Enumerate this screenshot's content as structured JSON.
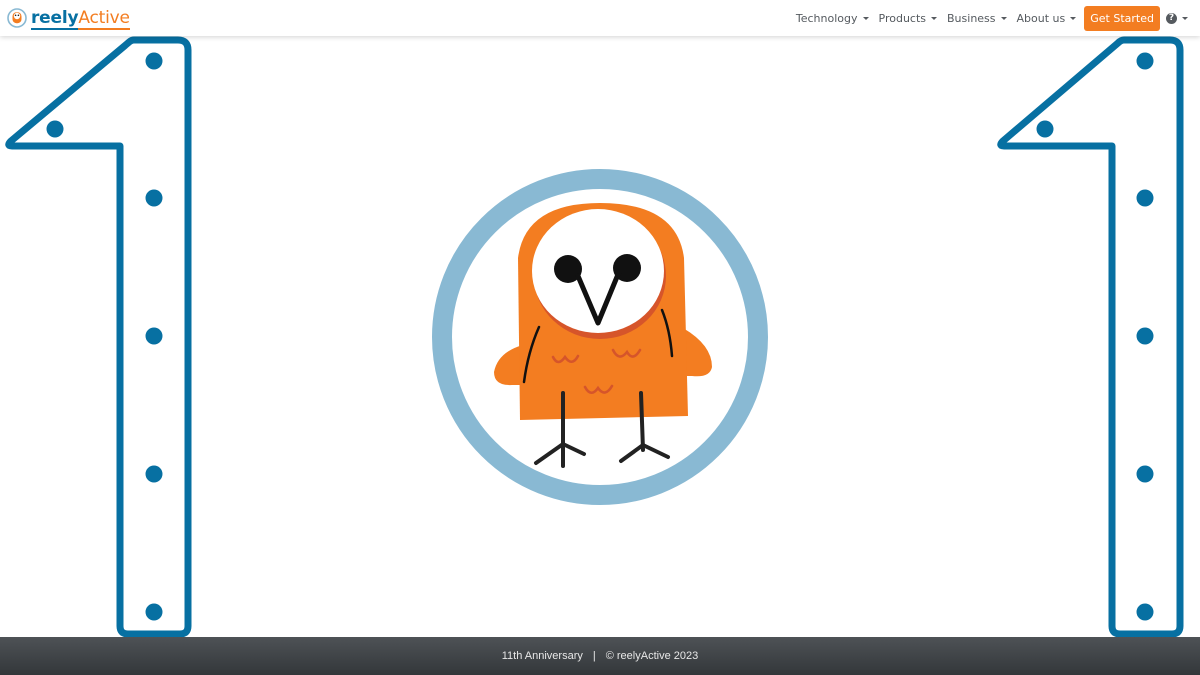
{
  "brand": {
    "name_part1": "reely",
    "name_part2": "Active"
  },
  "nav": {
    "items": [
      {
        "label": "Technology",
        "has_dropdown": true
      },
      {
        "label": "Products",
        "has_dropdown": true
      },
      {
        "label": "Business",
        "has_dropdown": true
      },
      {
        "label": "About us",
        "has_dropdown": true
      }
    ],
    "cta_label": "Get Started",
    "help_icon": "question-circle-icon"
  },
  "hero": {
    "digits": [
      "1",
      "1"
    ],
    "mascot": "owl-mascot",
    "colors": {
      "primary": "#0770a2",
      "accent": "#f37d21",
      "ring": "#89b9d3"
    }
  },
  "footer": {
    "anniversary": "11th Anniversary",
    "separator": "|",
    "copyright": "© reelyActive 2023"
  }
}
